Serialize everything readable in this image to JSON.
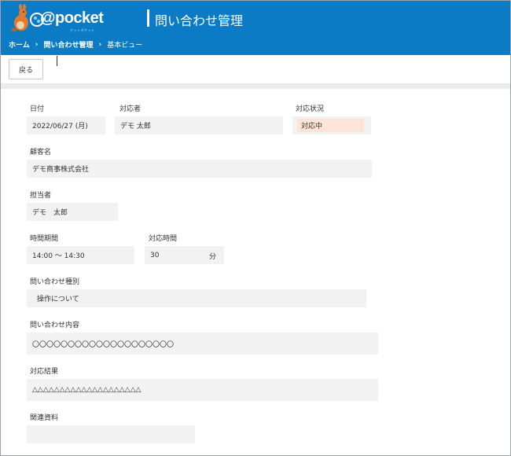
{
  "header": {
    "logo_text": "@pocket",
    "logo_subtext": "アットポケット",
    "app_title": "問い合わせ管理",
    "accent_color": "#0a7bc4"
  },
  "breadcrumb": {
    "items": [
      "ホーム",
      "問い合わせ管理",
      "基本ビュー"
    ],
    "separator": "›"
  },
  "toolbar": {
    "back_label": "戻る"
  },
  "form": {
    "date": {
      "label": "日付",
      "value": "2022/06/27 (月)"
    },
    "responder": {
      "label": "対応者",
      "value": "デモ 太郎"
    },
    "status": {
      "label": "対応状況",
      "value": "対応中",
      "color": "#fde4d7"
    },
    "customer": {
      "label": "顧客名",
      "value": "デモ商事株式会社"
    },
    "assignee": {
      "label": "担当者",
      "value": "デモ　太郎"
    },
    "time_period": {
      "label": "時間期間",
      "value": "14:00 〜 14:30"
    },
    "duration": {
      "label": "対応時間",
      "value": "30",
      "unit": "分"
    },
    "inquiry_type": {
      "label": "問い合わせ種別",
      "value": "操作について"
    },
    "inquiry_content": {
      "label": "問い合わせ内容",
      "value": "〇〇〇〇〇〇〇〇〇〇〇〇〇〇〇〇〇〇〇〇"
    },
    "result": {
      "label": "対応結果",
      "value": "△△△△△△△△△△△△△△△△△△△△"
    },
    "attachments": {
      "label": "関連資料",
      "value": ""
    }
  }
}
